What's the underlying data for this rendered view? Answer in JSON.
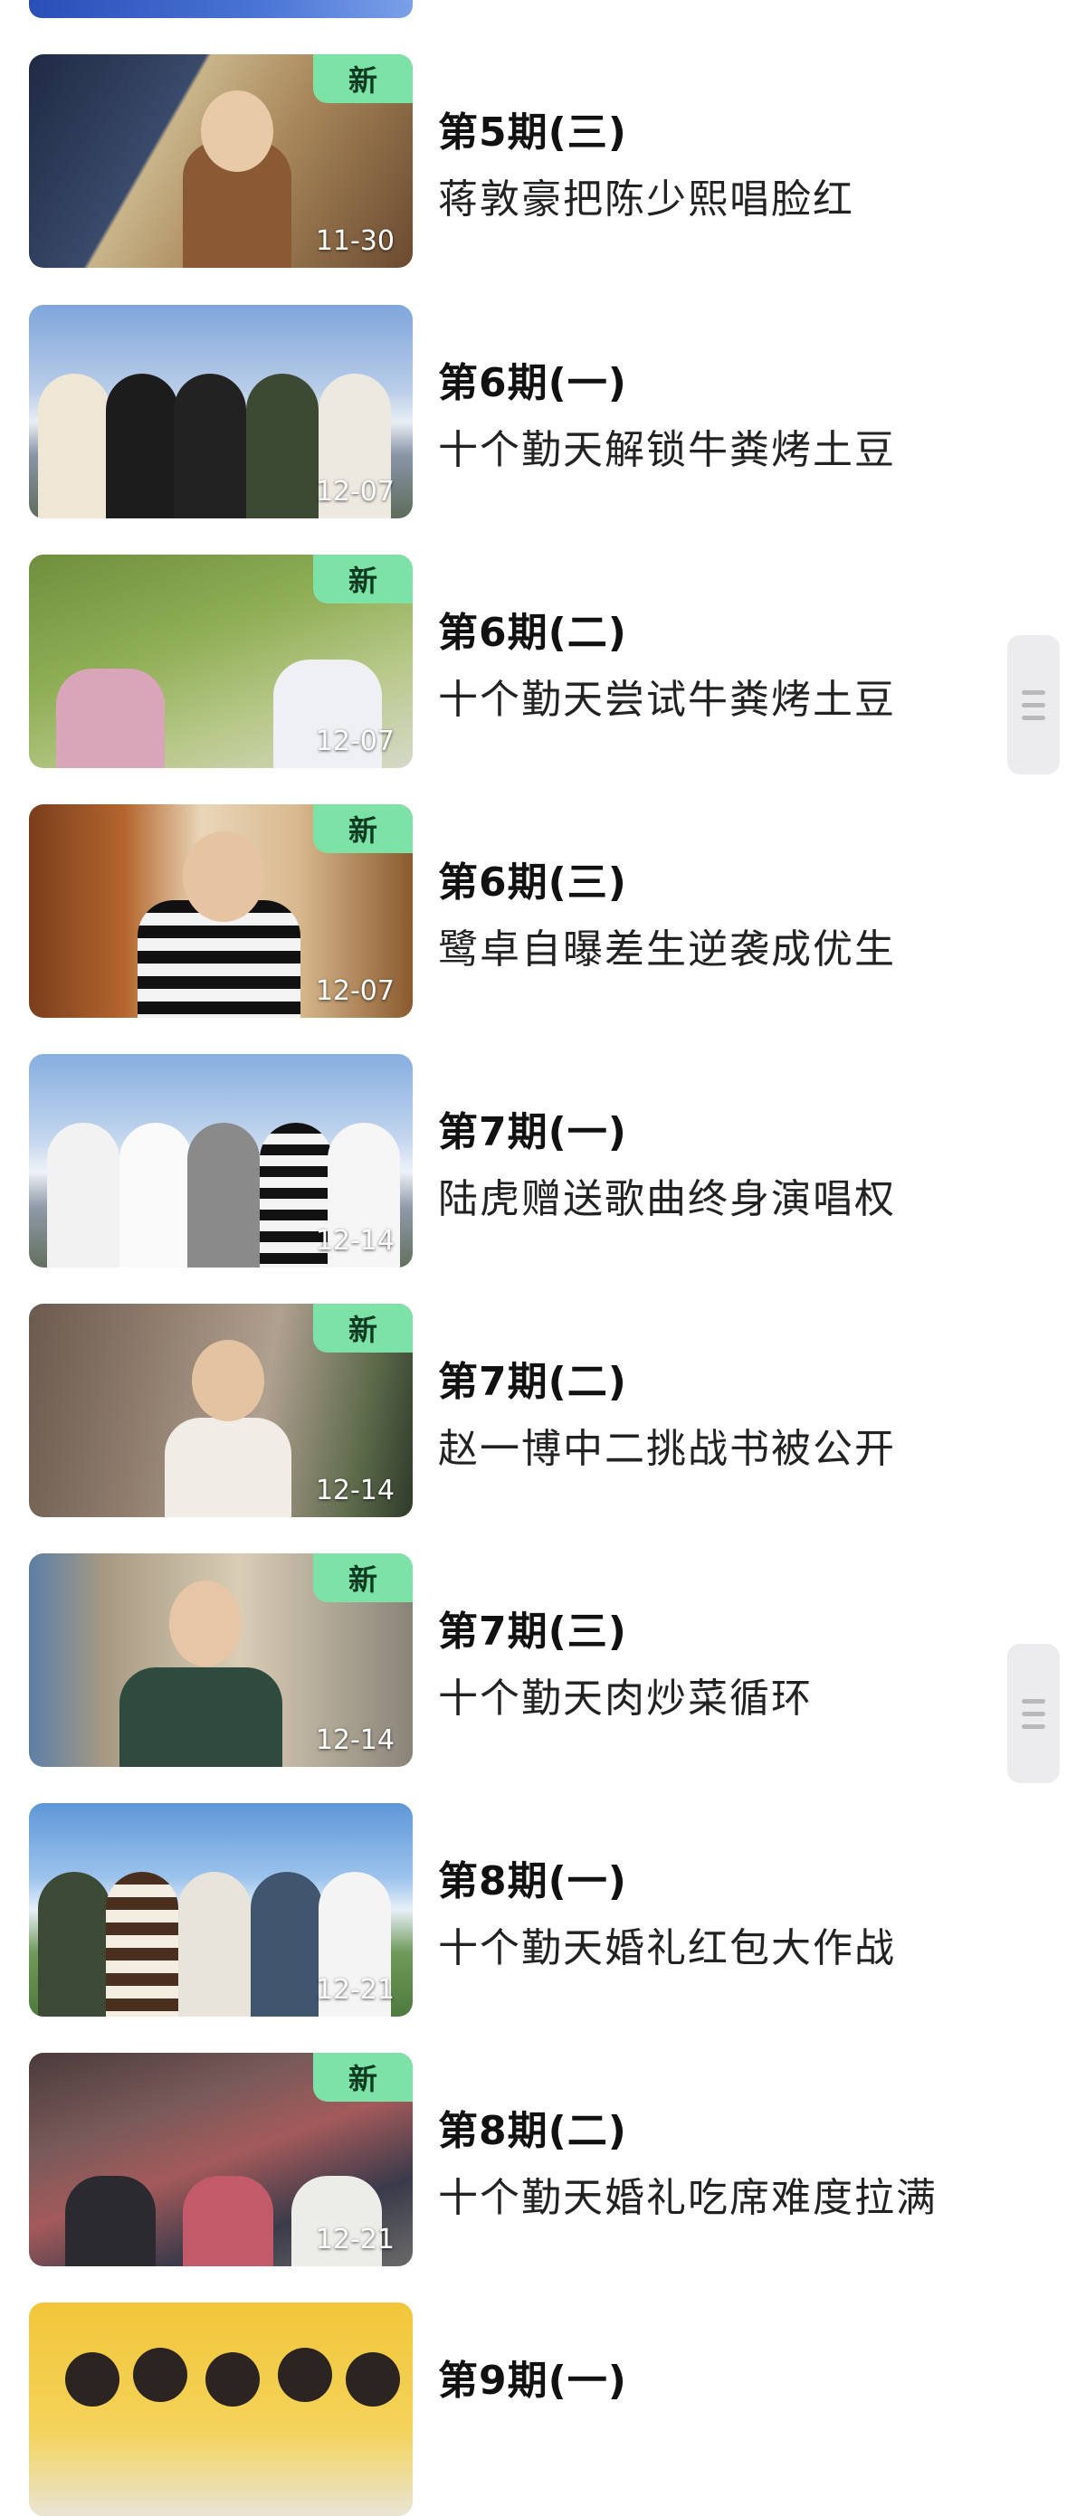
{
  "episodes": [
    {
      "title": "第5期(三)",
      "subtitle": "蒋敦豪把陈少熙唱脸红",
      "date": "11-30",
      "is_new": true,
      "new_label": "新"
    },
    {
      "title": "第6期(一)",
      "subtitle": "十个勤天解锁牛粪烤土豆",
      "date": "12-07",
      "is_new": false,
      "new_label": ""
    },
    {
      "title": "第6期(二)",
      "subtitle": "十个勤天尝试牛粪烤土豆",
      "date": "12-07",
      "is_new": true,
      "new_label": "新"
    },
    {
      "title": "第6期(三)",
      "subtitle": "鹭卓自曝差生逆袭成优生",
      "date": "12-07",
      "is_new": true,
      "new_label": "新"
    },
    {
      "title": "第7期(一)",
      "subtitle": "陆虎赠送歌曲终身演唱权",
      "date": "12-14",
      "is_new": false,
      "new_label": ""
    },
    {
      "title": "第7期(二)",
      "subtitle": "赵一博中二挑战书被公开",
      "date": "12-14",
      "is_new": true,
      "new_label": "新"
    },
    {
      "title": "第7期(三)",
      "subtitle": "十个勤天肉炒菜循环",
      "date": "12-14",
      "is_new": true,
      "new_label": "新"
    },
    {
      "title": "第8期(一)",
      "subtitle": "十个勤天婚礼红包大作战",
      "date": "12-21",
      "is_new": false,
      "new_label": ""
    },
    {
      "title": "第8期(二)",
      "subtitle": "十个勤天婚礼吃席难度拉满",
      "date": "12-21",
      "is_new": true,
      "new_label": "新"
    },
    {
      "title": "第9期(一)",
      "subtitle": "",
      "date": "",
      "is_new": false,
      "new_label": ""
    }
  ],
  "colors": {
    "new_badge": "#7de2a5",
    "title": "#111111",
    "scroll_handle": "#ececee"
  },
  "icons": {
    "scroll_handle": "drag-handle-icon"
  }
}
